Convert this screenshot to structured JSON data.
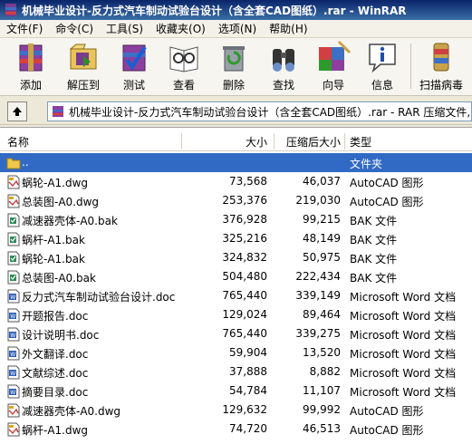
{
  "window": {
    "title": "机械毕业设计-反力式汽车制动试验台设计（含全套CAD图纸）.rar - WinRAR"
  },
  "menu": [
    "文件(F)",
    "命令(C)",
    "工具(S)",
    "收藏夹(O)",
    "选项(N)",
    "帮助(H)"
  ],
  "toolbar": [
    {
      "label": "添加",
      "icon": "add-archive-icon"
    },
    {
      "label": "解压到",
      "icon": "extract-to-icon"
    },
    {
      "label": "测试",
      "icon": "test-icon"
    },
    {
      "label": "查看",
      "icon": "view-icon"
    },
    {
      "label": "删除",
      "icon": "delete-icon"
    },
    {
      "label": "查找",
      "icon": "find-icon"
    },
    {
      "label": "向导",
      "icon": "wizard-icon"
    },
    {
      "label": "信息",
      "icon": "info-icon"
    },
    {
      "label": "扫描病毒",
      "icon": "virus-scan-icon"
    }
  ],
  "address": {
    "path": "机械毕业设计-反力式汽车制动试验台设计（含全套CAD图纸）.rar - RAR 压缩文件, 解"
  },
  "columns": {
    "name": "名称",
    "size": "大小",
    "packed": "压缩后大小",
    "type": "类型"
  },
  "files": [
    {
      "name": "..",
      "size": "",
      "packed": "",
      "type": "文件夹",
      "kind": "folder",
      "selected": true
    },
    {
      "name": "蜗轮-A1.dwg",
      "size": "73,568",
      "packed": "46,037",
      "type": "AutoCAD 图形",
      "kind": "dwg"
    },
    {
      "name": "总装图-A0.dwg",
      "size": "253,376",
      "packed": "219,030",
      "type": "AutoCAD 图形",
      "kind": "dwg"
    },
    {
      "name": "减速器壳体-A0.bak",
      "size": "376,928",
      "packed": "99,215",
      "type": "BAK 文件",
      "kind": "bak"
    },
    {
      "name": "蜗杆-A1.bak",
      "size": "325,216",
      "packed": "48,149",
      "type": "BAK 文件",
      "kind": "bak"
    },
    {
      "name": "蜗轮-A1.bak",
      "size": "324,832",
      "packed": "50,975",
      "type": "BAK 文件",
      "kind": "bak"
    },
    {
      "name": "总装图-A0.bak",
      "size": "504,480",
      "packed": "222,434",
      "type": "BAK 文件",
      "kind": "bak"
    },
    {
      "name": "反力式汽车制动试验台设计.doc",
      "size": "765,440",
      "packed": "339,149",
      "type": "Microsoft Word 文档",
      "kind": "doc"
    },
    {
      "name": "开题报告.doc",
      "size": "129,024",
      "packed": "89,464",
      "type": "Microsoft Word 文档",
      "kind": "doc"
    },
    {
      "name": "设计说明书.doc",
      "size": "765,440",
      "packed": "339,275",
      "type": "Microsoft Word 文档",
      "kind": "doc"
    },
    {
      "name": "外文翻译.doc",
      "size": "59,904",
      "packed": "13,520",
      "type": "Microsoft Word 文档",
      "kind": "doc"
    },
    {
      "name": "文献综述.doc",
      "size": "37,888",
      "packed": "8,882",
      "type": "Microsoft Word 文档",
      "kind": "doc"
    },
    {
      "name": "摘要目录.doc",
      "size": "54,784",
      "packed": "11,107",
      "type": "Microsoft Word 文档",
      "kind": "doc"
    },
    {
      "name": "减速器壳体-A0.dwg",
      "size": "129,632",
      "packed": "99,992",
      "type": "AutoCAD 图形",
      "kind": "dwg"
    },
    {
      "name": "蜗杆-A1.dwg",
      "size": "74,720",
      "packed": "46,513",
      "type": "AutoCAD 图形",
      "kind": "dwg"
    }
  ]
}
